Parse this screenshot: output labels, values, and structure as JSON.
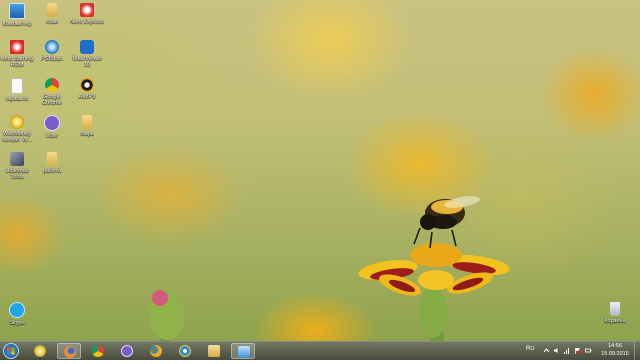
{
  "desktop": {
    "icons": [
      {
        "label": "Компьютер",
        "icon": "computer-icon"
      },
      {
        "label": "сеаи",
        "icon": "folder-icon"
      },
      {
        "label": "Nero Express",
        "icon": "nero-express-icon"
      },
      {
        "label": "Nero Burning ROM",
        "icon": "nero-burning-rom-icon"
      },
      {
        "label": "PSIScan",
        "icon": "psiscan-icon"
      },
      {
        "label": "TeamViewer 10",
        "icon": "teamviewer-icon"
      },
      {
        "label": "сарна.txt",
        "icon": "text-file-icon"
      },
      {
        "label": "Google Chrome",
        "icon": "chrome-icon"
      },
      {
        "label": "AIMP3",
        "icon": "aimp-icon"
      },
      {
        "label": "WebMoney Keeper W...",
        "icon": "webmoney-icon"
      },
      {
        "label": "Viber",
        "icon": "viber-icon"
      },
      {
        "label": "Марь",
        "icon": "folder-icon"
      },
      {
        "label": "Universal Tools",
        "icon": "tools-icon"
      },
      {
        "label": "работа",
        "icon": "folder-icon"
      },
      {
        "label": "Skype",
        "icon": "skype-icon"
      },
      {
        "label": "Корзина",
        "icon": "recycle-bin-icon"
      }
    ]
  },
  "taskbar": {
    "start_icon": "windows-orb-icon",
    "pinned": [
      {
        "name": "webmoney-taskbar-icon",
        "color": "#e3c13a"
      },
      {
        "name": "firefox-taskbar-icon",
        "color": "#e86a1f",
        "active": true
      },
      {
        "name": "chrome-taskbar-icon",
        "color": "#3b9c4c"
      },
      {
        "name": "viber-taskbar-icon",
        "color": "#7b5cc8"
      },
      {
        "name": "paint-taskbar-icon",
        "color": "#f0a829"
      },
      {
        "name": "ie-taskbar-icon",
        "color": "#2f8fd8"
      },
      {
        "name": "explorer-taskbar-icon",
        "color": "#e6c36a"
      },
      {
        "name": "remote-desktop-taskbar-icon",
        "color": "#3a8fd0",
        "active": true
      }
    ],
    "tray": {
      "language": "RU",
      "icons": [
        "show-hidden-icon",
        "volume-icon",
        "network-icon",
        "flag-icon",
        "power-icon"
      ],
      "time": "14:56",
      "date": "15.09.2015"
    }
  },
  "colors": {
    "label_text": "#ffffff",
    "taskbar_bg": "#4a4f3a"
  }
}
